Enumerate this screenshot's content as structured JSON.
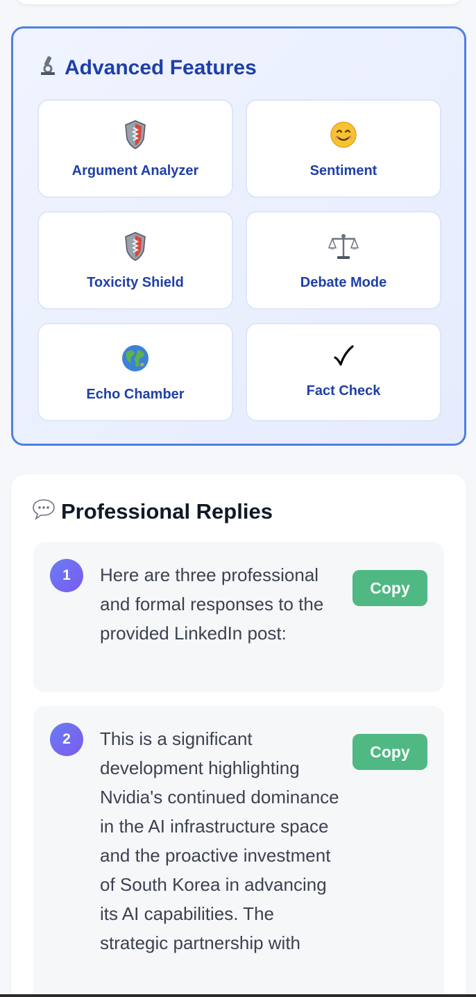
{
  "features": {
    "title": "Advanced Features",
    "title_icon": "microscope-icon",
    "tiles": [
      {
        "label": "Argument Analyzer",
        "icon": "shield-icon"
      },
      {
        "label": "Sentiment",
        "icon": "smiley-face-icon"
      },
      {
        "label": "Toxicity Shield",
        "icon": "shield-icon"
      },
      {
        "label": "Debate Mode",
        "icon": "balance-scale-icon"
      },
      {
        "label": "Echo Chamber",
        "icon": "globe-icon"
      },
      {
        "label": "Fact Check",
        "icon": "check-mark-icon"
      }
    ]
  },
  "replies": {
    "title": "Professional Replies",
    "title_icon": "speech-bubble-icon",
    "items": [
      {
        "number": "1",
        "text": "Here are three professional and formal responses to the provided LinkedIn post:",
        "copy_label": "Copy"
      },
      {
        "number": "2",
        "text": "This is a significant development highlighting Nvidia's continued dominance in the AI infrastructure space and the proactive investment of South Korea in advancing its AI capabilities. The strategic partnership with",
        "copy_label": "Copy"
      }
    ]
  },
  "colors": {
    "accent_blue": "#1e3fa8",
    "card_border": "#4d7fe3",
    "copy_green": "#4fb883",
    "badge_purple": "#6a7bf2"
  }
}
